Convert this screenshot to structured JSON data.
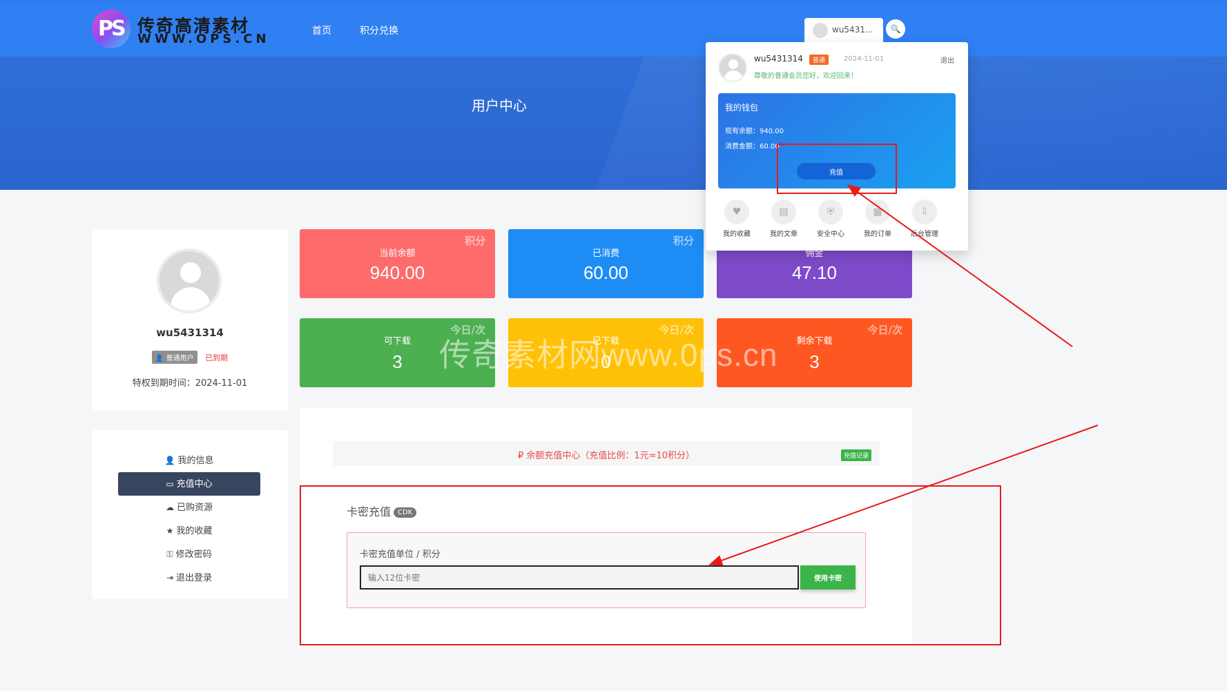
{
  "site": {
    "logo_mark": "PS",
    "logo_title": "传奇高清素材",
    "logo_url": "WWW.OPS.CN",
    "nav": [
      "首页",
      "积分兑换"
    ]
  },
  "banner": {
    "title": "用户中心"
  },
  "header_user": {
    "tab_name": "wu5431..."
  },
  "profile": {
    "username": "wu5431314",
    "role_badge": "普通用户",
    "status": "已到期",
    "expire_label": "特权到期时间：",
    "expire_date": "2024-11-01"
  },
  "menu": [
    {
      "icon": "user-icon",
      "glyph": "👤",
      "label": "我的信息",
      "active": false
    },
    {
      "icon": "card-icon",
      "glyph": "▭",
      "label": "充值中心",
      "active": true
    },
    {
      "icon": "cloud-download-icon",
      "glyph": "☁",
      "label": "已购资源",
      "active": false
    },
    {
      "icon": "star-icon",
      "glyph": "★",
      "label": "我的收藏",
      "active": false
    },
    {
      "icon": "key-icon",
      "glyph": "⚿",
      "label": "修改密码",
      "active": false
    },
    {
      "icon": "logout-icon",
      "glyph": "⇥",
      "label": "退出登录",
      "active": false
    }
  ],
  "stats": [
    {
      "corner": "积分",
      "label": "当前余额",
      "value": "940.00",
      "color": "#fe6b6b"
    },
    {
      "corner": "积分",
      "label": "已消费",
      "value": "60.00",
      "color": "#1e8cf5"
    },
    {
      "corner": "",
      "label": "佣金",
      "value": "47.10",
      "color": "#7d4ac9"
    },
    {
      "corner": "今日/次",
      "label": "可下载",
      "value": "3",
      "color": "#4caf50"
    },
    {
      "corner": "今日/次",
      "label": "已下载",
      "value": "0",
      "color": "#ffc107"
    },
    {
      "corner": "今日/次",
      "label": "剩余下载",
      "value": "3",
      "color": "#ff5722"
    }
  ],
  "recharge": {
    "notice": "₽ 余额充值中心（充值比例：1元=10积分）",
    "record_button": "充值记录",
    "cdk_title": "卡密充值",
    "cdk_tag": "CDK",
    "cdk_label": "卡密充值单位 / 积分",
    "cdk_placeholder": "输入12位卡密",
    "cdk_button": "使用卡密"
  },
  "dropdown": {
    "username": "wu5431314",
    "level": "普通",
    "date": "2024-11-01",
    "logout": "退出",
    "greeting": "尊敬的普通会员您好，欢迎回来！",
    "wallet_title": "我的钱包",
    "balance_line": "现有余额：940.00",
    "spent_line": "消费金额：60.00",
    "recharge_button": "充值",
    "actions": [
      {
        "icon": "heart-icon",
        "glyph": "♥",
        "label": "我的收藏"
      },
      {
        "icon": "document-icon",
        "glyph": "▤",
        "label": "我的文章"
      },
      {
        "icon": "shield-icon",
        "glyph": "⛨",
        "label": "安全中心"
      },
      {
        "icon": "order-icon",
        "glyph": "▦",
        "label": "我的订单"
      },
      {
        "icon": "download-icon",
        "glyph": "⇩",
        "label": "后台管理"
      }
    ]
  },
  "watermark": "传奇素材网www.0ps.cn",
  "colors": {
    "header": "#2f80f2",
    "annotation": "#e81a1a",
    "menu_active": "#38455f"
  }
}
